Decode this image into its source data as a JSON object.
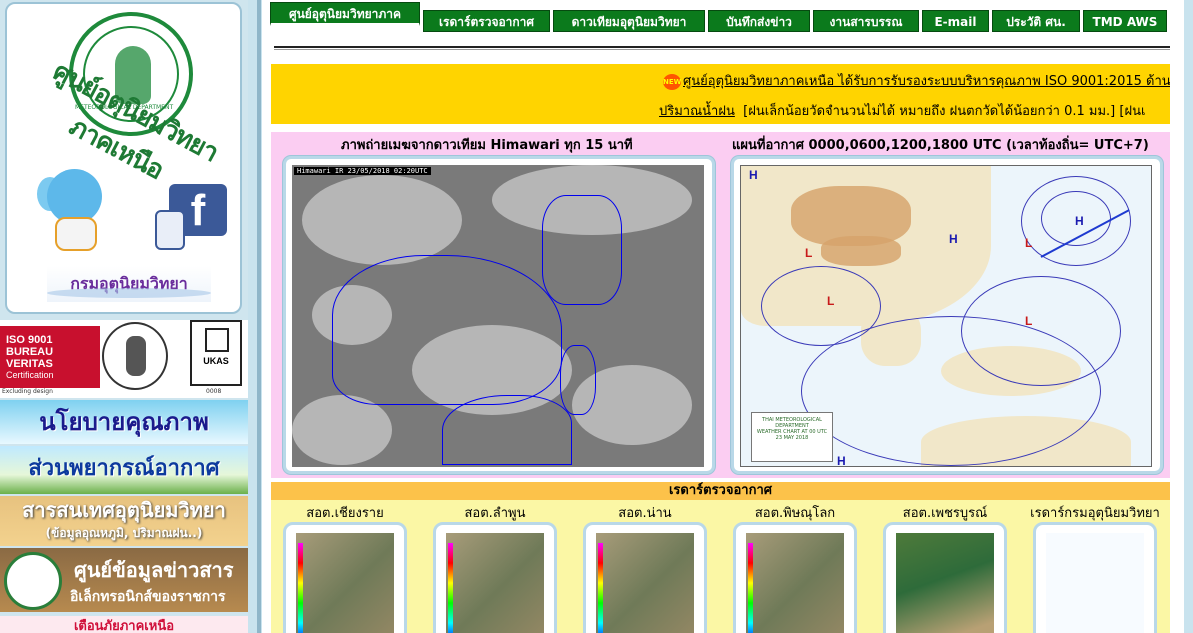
{
  "sidebar": {
    "logo_text": "ศูนย์อุตุนิยมวิทยาภาคเหนือ",
    "logo_ring": "METEOROLOGICAL DEPARTMENT",
    "facebook_letter": "f",
    "tmd_logo_text": "กรมอุตุนิยมวิทยา",
    "iso": {
      "bv_line1": "ISO 9001",
      "bv_line2": "BUREAU VERITAS",
      "bv_line3": "Certification",
      "bv_note": "Excluding design",
      "bv_year": "1828",
      "ukas_line1": "UKAS",
      "ukas_line2": "MANAGEMENT SYSTEMS",
      "ukas_code": "0008"
    },
    "banners": {
      "policy": "นโยบายคุณภาพ",
      "forecast": "ส่วนพยากรณ์อากาศ",
      "info_title": "สารสนเทศอุตุนิยมวิทยา",
      "info_sub": "(ข้อมูลอุณหภูมิ, ปริมาณฝน..)",
      "news_title": "ศูนย์ข้อมูลข่าวสาร",
      "news_sub": "อิเล็กทรอนิกส์ของราชการ",
      "warning": "เตือนภัยภาคเหนือ"
    }
  },
  "nav": {
    "items": [
      "ศูนย์อุตุนิยมวิทยาภาค",
      "เรดาร์ตรวจอากาศ",
      "ดาวเทียมอุตุนิยมวิทยา",
      "บันทึกส่งข่าว",
      "งานสารบรรณ",
      "E-mail",
      "ประวัติ ศน.",
      "TMD AWS"
    ]
  },
  "marquee": {
    "new_badge": "NEW",
    "line1": "ศูนย์อุตุนิยมวิทยาภาคเหนือ ได้รับการรับรองระบบบริหารคุณภาพ ISO 9001:2015 ด้าน",
    "line2_link": "ปริมาณน้ำฝน",
    "line2": "[ฝนเล็กน้อยวัดจำนวนไม่ได้ หมายถึง ฝนตกวัดได้น้อยกว่า 0.1 มม.]  [ฝนเ"
  },
  "satellite": {
    "title": "ภาพถ่ายเมฆจากดาวเทียม Himawari ทุก 15 นาที",
    "stamp": "Himawari IR 23/05/2018 02:20UTC"
  },
  "weather_map": {
    "title": "แผนที่อากาศ 0000,0600,1200,1800 UTC (เวลาท้องถิ่น= UTC+7)",
    "legend_line1": "THAI METEOROLOGICAL DEPARTMENT",
    "legend_line2": "WEATHER CHART AT 00 UTC",
    "legend_line3": "23 MAY 2018",
    "high_label": "H",
    "low_label": "L"
  },
  "radar": {
    "header": "เรดาร์ตรวจอากาศ",
    "stations": [
      "สอต.เชียงราย",
      "สอต.ลำพูน",
      "สอต.น่าน",
      "สอต.พิษณุโลก",
      "สอต.เพชรบูรณ์",
      "เรดาร์กรมอุตุนิยมวิทยา"
    ]
  },
  "colors": {
    "nav_green": "#0b7a1c",
    "marquee_yellow": "#ffd400",
    "images_panel_pink": "#fbcdf2",
    "radar_panel_yellow": "#fbf7a5",
    "radar_header_orange": "#fcc24a"
  }
}
